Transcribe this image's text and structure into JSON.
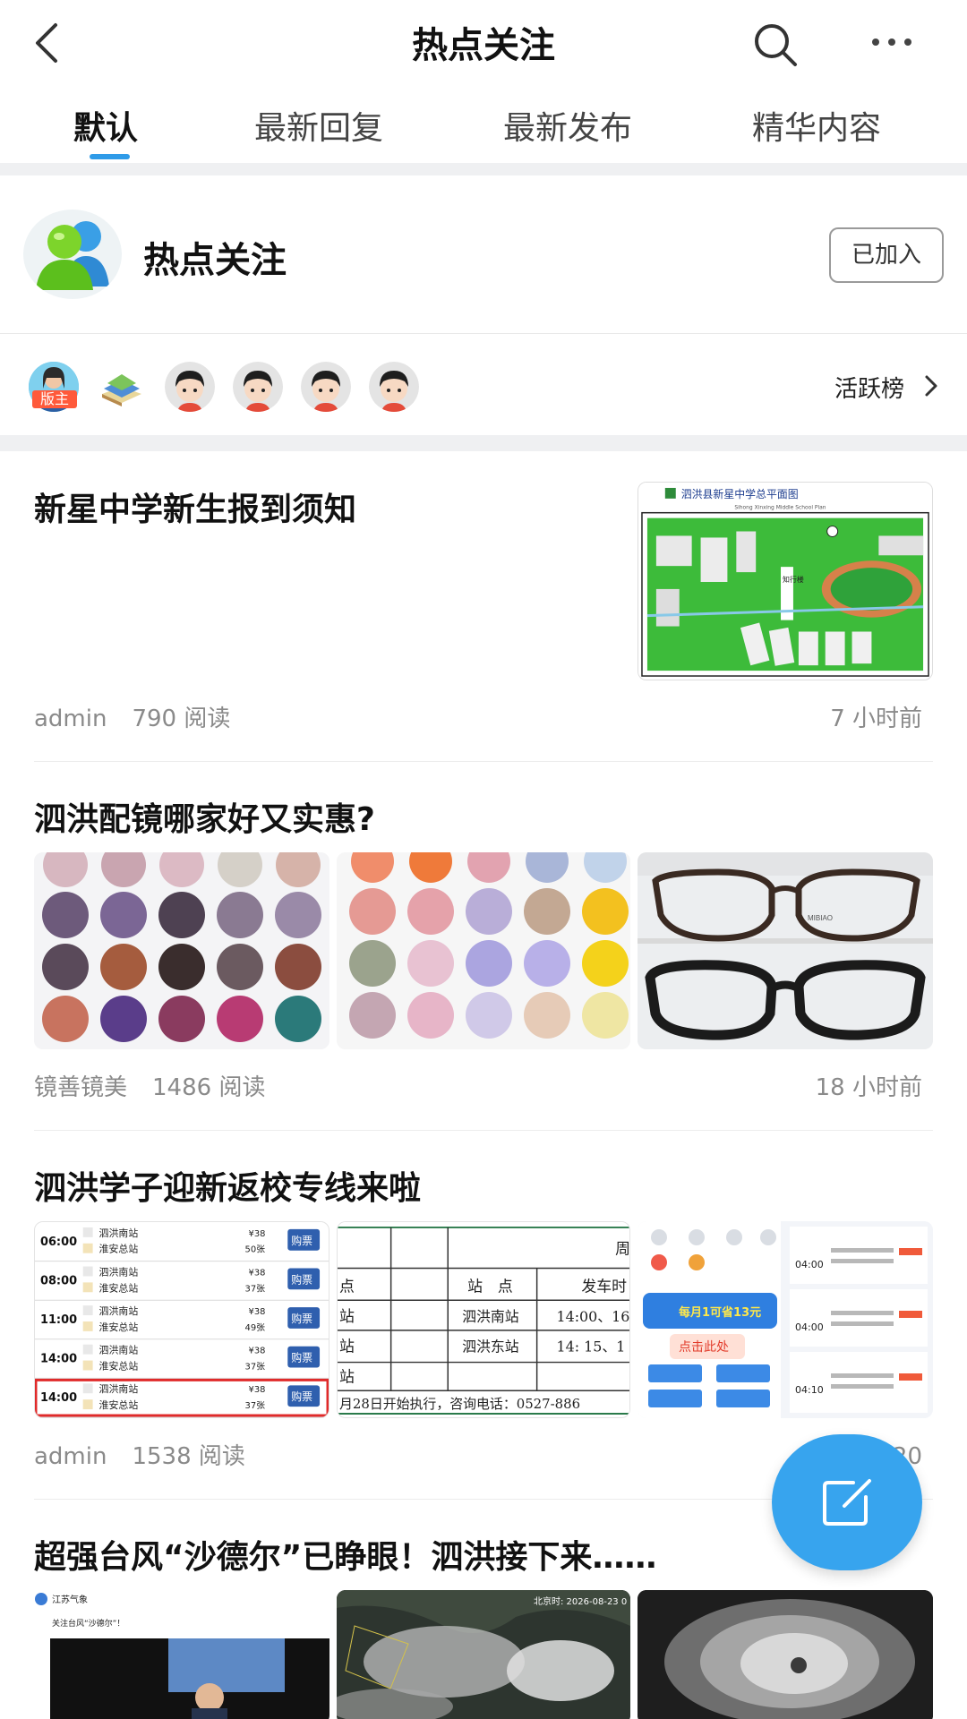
{
  "header": {
    "title": "热点关注"
  },
  "tabs": [
    {
      "label": "默认",
      "active": true
    },
    {
      "label": "最新回复",
      "active": false
    },
    {
      "label": "最新发布",
      "active": false
    },
    {
      "label": "精华内容",
      "active": false
    }
  ],
  "forum": {
    "name": "热点关注",
    "join_label": "已加入",
    "moderator_badge": "版主",
    "active_rank_label": "活跃榜"
  },
  "posts": [
    {
      "title": "新星中学新生报到须知",
      "author": "admin",
      "reads": "790 阅读",
      "time": "7 小时前",
      "image_caption": "泗洪县新星中学总平面图",
      "image_caption_en": "Sihong Xinxing Middle School Plan"
    },
    {
      "title": "泗洪配镜哪家好又实惠?",
      "author": "镜善镜美",
      "reads": "1486 阅读",
      "time": "18 小时前",
      "glasses_brand": "MIBIAO"
    },
    {
      "title": "泗洪学子迎新返校专线来啦",
      "author": "admin",
      "reads": "1538 阅读",
      "time": "昨天 20",
      "schedule": [
        {
          "time": "06:00",
          "from": "泗洪南站",
          "to": "淮安总站",
          "price": "¥38",
          "seats": "50张",
          "btn": "购票"
        },
        {
          "time": "08:00",
          "from": "泗洪南站",
          "to": "淮安总站",
          "price": "¥38",
          "seats": "37张",
          "btn": "购票"
        },
        {
          "time": "11:00",
          "from": "泗洪南站",
          "to": "淮安总站",
          "price": "¥38",
          "seats": "49张",
          "btn": "购票"
        },
        {
          "time": "14:00",
          "from": "泗洪南站",
          "to": "淮安总站",
          "price": "¥38",
          "seats": "37张",
          "btn": "购票"
        },
        {
          "time": "14:00",
          "from": "泗洪南站",
          "to": "淮安总站",
          "price": "¥38",
          "seats": "37张",
          "btn": "购票"
        }
      ],
      "table_headers": [
        "站　点",
        "发车时"
      ],
      "table_rows": [
        [
          "泗洪南站",
          "14:00、16"
        ],
        [
          "泗洪东站",
          "14: 15、1"
        ]
      ],
      "table_left_col": [
        "点",
        "站",
        "站",
        "站"
      ],
      "table_corner": "周",
      "table_note": "月28日开始执行，咨询电话：0527-886",
      "promo_text": "每月1可省13元",
      "promo_button": "点击此处",
      "ride_times": [
        "04:00",
        "04:00",
        "04:10"
      ]
    },
    {
      "title": "超强台风“沙德尔”已睁眼！泗洪接下来……",
      "weibo_name": "江苏气象",
      "weibo_text": "关注台风“沙德尔”！",
      "sat_stamp": "北京时: 2026-08-23 0"
    }
  ]
}
